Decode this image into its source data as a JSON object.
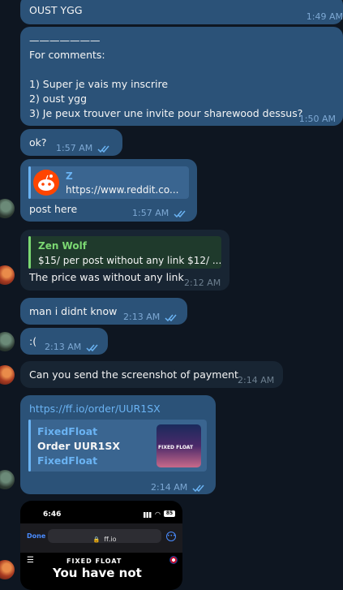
{
  "messages": [
    {
      "text": "OUST YGG",
      "time": "1:49 AM"
    },
    {
      "text": "———————\nFor comments:\n\n1) Super je vais my inscrire\n2) oust ygg\n3) Je peux trouver une invite pour sharewood dessus?",
      "time": "1:50 AM"
    },
    {
      "text": "ok?",
      "time": "1:57 AM"
    },
    {
      "preview_title": "Z",
      "preview_text": "https://www.reddit.co...",
      "text": "post here",
      "time": "1:57 AM"
    },
    {
      "reply_author": "Zen Wolf",
      "reply_text": "$15/ per post without any link $12/ ...",
      "text": "The price was without any link",
      "time": "2:12 AM"
    },
    {
      "text": "man i didnt know",
      "time": "2:13 AM"
    },
    {
      "text": ":(",
      "time": "2:13 AM"
    },
    {
      "text": "Can you send the screenshot of payment",
      "time": "2:14 AM"
    },
    {
      "link": "https://ff.io/order/UUR1SX",
      "preview_site": "FixedFloat",
      "preview_title": "Order UUR1SX",
      "preview_desc": "FixedFloat",
      "thumb_logo": "FIXED FLOAT",
      "time": "2:14 AM"
    }
  ],
  "shot": {
    "time": "6:46",
    "battery": "85",
    "done": "Done",
    "url": "ff.io",
    "logo": "FIXED FLOAT",
    "headline": "You have not"
  },
  "colors": {
    "outgoing": "#2b5278",
    "incoming": "#182533",
    "background": "#0e1621",
    "link": "#6ab3f3",
    "reply_author": "#7bd872"
  }
}
